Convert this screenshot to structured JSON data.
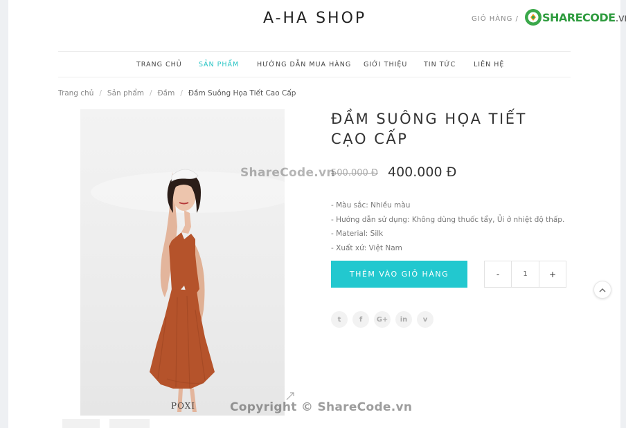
{
  "header": {
    "logo": "A-HA SHOP",
    "cart_label": "GIỎ HÀNG /"
  },
  "watermark_logo": {
    "brand": "SHARECODE",
    "tld": ".vn"
  },
  "nav": {
    "items": [
      {
        "label": "TRANG CHỦ",
        "active": false
      },
      {
        "label": "SẢN PHẨM",
        "active": true
      },
      {
        "label": "HƯỚNG DẪN MUA HÀNG",
        "active": false
      },
      {
        "label": "GIỚI THIỆU",
        "active": false
      },
      {
        "label": "TIN TỨC",
        "active": false
      },
      {
        "label": "LIÊN HỆ",
        "active": false
      }
    ]
  },
  "breadcrumb": {
    "items": [
      "Trang chủ",
      "Sản phẩm",
      "Đầm"
    ],
    "current": "Đầm Suông Họa Tiết Cao Cấp",
    "separator": "/"
  },
  "product": {
    "title_line1": "ĐẦM SUÔNG HỌA TIẾT",
    "title_line2": "CẠO CẤP",
    "old_price": "500.000 Đ",
    "price": "400.000 Đ",
    "image_caption": "POXI",
    "details": [
      "- Màu sắc: Nhiều màu",
      "- Hướng dẫn sử dụng: Không dùng thuốc tẩy, Ủi ở nhiệt độ thấp.",
      "- Material: Silk",
      "- Xuất xứ: Việt Nam"
    ],
    "add_to_cart": "THÊM VÀO GIỎ HÀNG",
    "quantity": {
      "minus": "-",
      "value": "1",
      "plus": "+"
    }
  },
  "social": [
    {
      "name": "twitter-icon",
      "glyph": "t"
    },
    {
      "name": "facebook-icon",
      "glyph": "f"
    },
    {
      "name": "google-plus-icon",
      "glyph": "G+"
    },
    {
      "name": "linkedin-icon",
      "glyph": "in"
    },
    {
      "name": "vimeo-icon",
      "glyph": "v"
    }
  ],
  "watermarks": {
    "center": "ShareCode.vn",
    "bottom": "Copyright © ShareCode.vn"
  },
  "colors": {
    "accent": "#22c8cf",
    "nav_active": "#27c4c4",
    "dress": "#b5532b"
  }
}
